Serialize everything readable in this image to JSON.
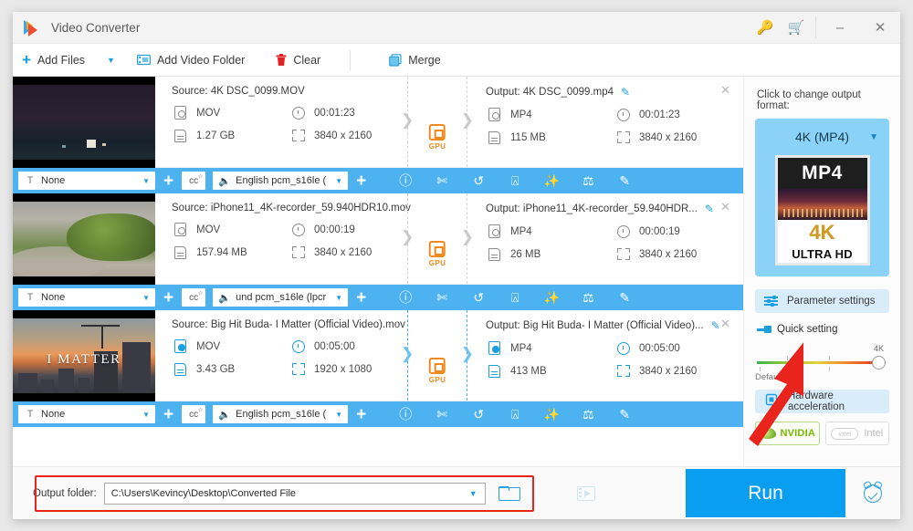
{
  "window": {
    "title": "Video Converter",
    "key_icon": "key-icon",
    "cart_icon": "cart-icon",
    "minimize": "–",
    "close": "✕"
  },
  "toolbar": {
    "add_files": "Add Files",
    "add_files_caret": "▼",
    "add_video_folder": "Add Video Folder",
    "clear": "Clear",
    "merge": "Merge"
  },
  "files": [
    {
      "source_title": "Source: 4K DSC_0099.MOV",
      "source_format": "MOV",
      "source_duration": "00:01:23",
      "source_size": "1.27 GB",
      "source_resolution": "3840 x 2160",
      "output_title": "Output: 4K DSC_0099.mp4",
      "output_format": "MP4",
      "output_duration": "00:01:23",
      "output_size": "115 MB",
      "output_resolution": "3840 x 2160",
      "gpu_label": "GPU",
      "subtitle_value": "None",
      "audio_value": "English pcm_s16le (",
      "selected": false
    },
    {
      "source_title": "Source: iPhone11_4K-recorder_59.940HDR10.mov",
      "source_format": "MOV",
      "source_duration": "00:00:19",
      "source_size": "157.94 MB",
      "source_resolution": "3840 x 2160",
      "output_title": "Output: iPhone11_4K-recorder_59.940HDR...",
      "output_format": "MP4",
      "output_duration": "00:00:19",
      "output_size": "26 MB",
      "output_resolution": "3840 x 2160",
      "gpu_label": "GPU",
      "subtitle_value": "None",
      "audio_value": "und pcm_s16le (lpcr",
      "selected": false
    },
    {
      "source_title": "Source: Big Hit Buda- I Matter (Official Video).mov",
      "source_format": "MOV",
      "source_duration": "00:05:00",
      "source_size": "3.43 GB",
      "source_resolution": "1920 x 1080",
      "output_title": "Output: Big Hit Buda- I Matter (Official Video)...",
      "output_format": "MP4",
      "output_duration": "00:05:00",
      "output_size": "413 MB",
      "output_resolution": "3840 x 2160",
      "gpu_label": "GPU",
      "subtitle_value": "None",
      "audio_value": "English pcm_s16le (",
      "selected": true,
      "thumb_text": "I MATTER"
    }
  ],
  "action_icons": [
    "info-icon",
    "cut-icon",
    "rotate-icon",
    "crop-icon",
    "effect-icon",
    "watermark-icon",
    "edit-icon"
  ],
  "right_panel": {
    "header": "Click to change output format:",
    "format_name": "4K (MP4)",
    "format_caret": "▼",
    "poster_top": "MP4",
    "poster_4k": "4K",
    "poster_hd": "ULTRA HD",
    "parameter_settings": "Parameter settings",
    "quick_setting": "Quick setting",
    "slider_max_label": "4K",
    "slider_min_label": "Default",
    "hardware_acceleration": "Hardware acceleration",
    "nvidia": "NVIDIA",
    "intel_badge": "intel",
    "intel": "Intel"
  },
  "bottom": {
    "output_folder_label": "Output folder:",
    "output_folder_value": "C:\\Users\\Kevincy\\Desktop\\Converted File",
    "output_folder_caret": "▼",
    "browse_icon": "folder-icon",
    "preview_icon": "film-preview-icon",
    "run": "Run",
    "schedule_icon": "alarm-clock-icon"
  },
  "colors": {
    "accent": "#0a9ef0",
    "action_bar": "#4db2f0",
    "gpu": "#f08a1d",
    "highlight_box": "#e8241c",
    "nvidia": "#76b900"
  }
}
